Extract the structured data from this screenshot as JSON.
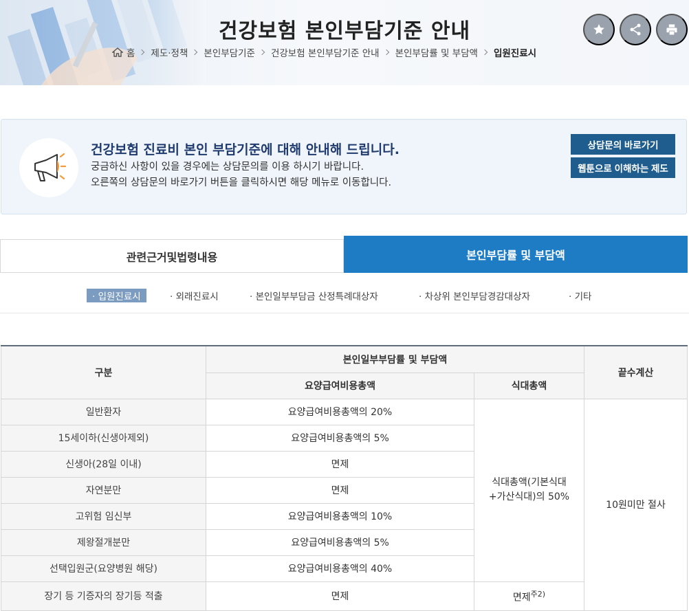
{
  "header": {
    "title": "건강보험 본인부담기준 안내",
    "breadcrumb": [
      "홈",
      "제도·정책",
      "본인부담기준",
      "건강보험 본인부담기준 안내",
      "본인부담률 및 부담액",
      "입원진료시"
    ]
  },
  "toolbar": {
    "icons": [
      "star-icon",
      "share-icon",
      "print-icon"
    ]
  },
  "notice": {
    "title": "건강보험 진료비 본인 부담기준에 대해 안내해 드립니다.",
    "line1": "궁금하신 사항이 있을 경우에는 상담문의를 이용 하시기 바랍니다.",
    "line2": "오른쪽의 상담문의 바로가기 버튼을 클릭하시면 해당 메뉴로 이동합니다.",
    "button1": "상담문의 바로가기",
    "button2": "웹툰으로 이해하는 제도"
  },
  "tabs": [
    {
      "label": "관련근거및법령내용",
      "active": false
    },
    {
      "label": "본인부담률 및 부담액",
      "active": true
    }
  ],
  "subtabs": [
    {
      "label": "· 입원진료시",
      "active": true
    },
    {
      "label": "· 외래진료시",
      "active": false
    },
    {
      "label": "· 본인일부부담금 산정특례대상자",
      "active": false
    },
    {
      "label": "· 차상위 본인부담경감대상자",
      "active": false
    },
    {
      "label": "· 기타",
      "active": false
    }
  ],
  "table": {
    "head_category": "구분",
    "head_group": "본인일부부담률 및 부담액",
    "head_medical": "요양급여비용총액",
    "head_meal": "식대총액",
    "head_rounding": "끝수계산",
    "rows": [
      {
        "label": "일반환자",
        "medical": "요양급여비용총액의 20%"
      },
      {
        "label": "15세이하(신생아제외)",
        "medical": "요양급여비용총액의 5%"
      },
      {
        "label": "신생아(28일 이내)",
        "medical": "면제"
      },
      {
        "label": "자연분만",
        "medical": "면제"
      },
      {
        "label": "고위험 임신부",
        "medical": "요양급여비용총액의 10%"
      },
      {
        "label": "제왕절개분만",
        "medical": "요양급여비용총액의 5%"
      },
      {
        "label": "선택입원군(요양병원 해당)",
        "medical": "요양급여비용총액의 40%"
      }
    ],
    "meal_common": "식대총액(기본식대+가산식대)의 50%",
    "rounding_common": "10원미만 절사",
    "last_row": {
      "label": "장기 등 기증자의 장기등 적출",
      "medical": "면제",
      "meal": "면제",
      "meal_note": "주2)"
    }
  }
}
